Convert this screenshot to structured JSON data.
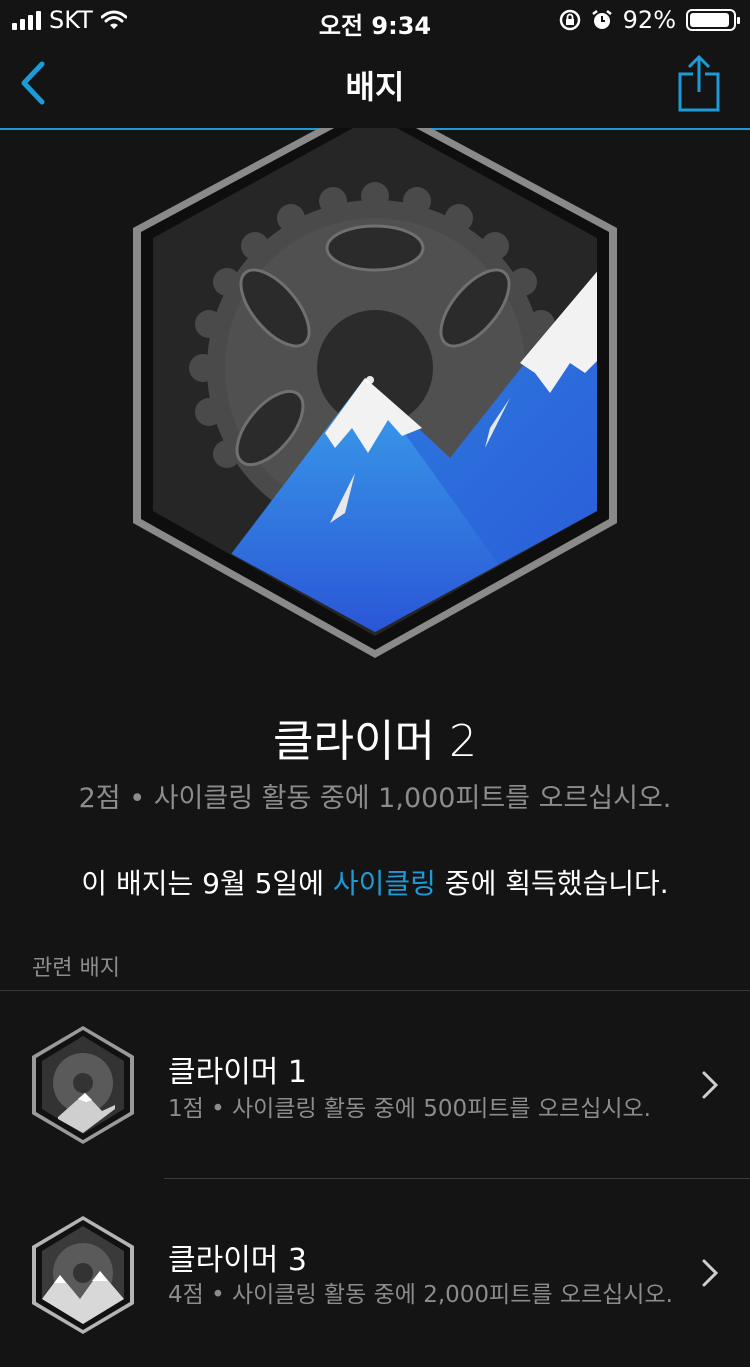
{
  "status": {
    "carrier": "SKT",
    "time": "오전 9:34",
    "battery_text": "92%",
    "battery_level": 0.92
  },
  "nav": {
    "title": "배지"
  },
  "badge": {
    "title": "클라이머 2",
    "description": "2점 • 사이클링 활동 중에 1,000피트를 오르십시오.",
    "earned_prefix": "이 배지는 9월 5일에 ",
    "earned_link": "사이클링",
    "earned_suffix": " 중에 획득했습니다."
  },
  "related": {
    "label": "관련 배지",
    "items": [
      {
        "name": "클라이머 1",
        "desc": "1점 • 사이클링 활동 중에 500피트를 오르십시오."
      },
      {
        "name": "클라이머 3",
        "desc": "4점 • 사이클링 활동 중에 2,000피트를 오르십시오."
      }
    ]
  },
  "colors": {
    "accent": "#1d9bd8",
    "background": "#141414",
    "secondary_text": "#8c8c8c",
    "mountain_blue": "#2f7fe0"
  },
  "icons": [
    "signal-icon",
    "wifi-icon",
    "rotation-lock-icon",
    "alarm-icon",
    "battery-icon",
    "back-chevron-icon",
    "share-icon",
    "chevron-right-icon"
  ]
}
